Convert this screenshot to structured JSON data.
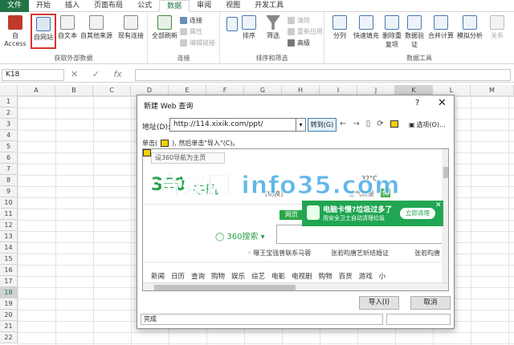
{
  "ribbon_tabs": [
    "文件",
    "开始",
    "插入",
    "页面布局",
    "公式",
    "数据",
    "审阅",
    "视图",
    "开发工具"
  ],
  "ribbon": {
    "get_external": {
      "label": "获取外部数据",
      "access": "自 Access",
      "web": "自网站",
      "text": "自文本",
      "other": "自其他来源",
      "existing": "现有连接"
    },
    "connections": {
      "label": "连接",
      "refresh_all": "全部刷新",
      "connections": "连接",
      "properties": "属性",
      "edit_links": "编辑链接"
    },
    "sort_filter": {
      "label": "排序和筛选",
      "sort": "排序",
      "filter": "筛选",
      "clear": "清除",
      "reapply": "重新应用",
      "advanced": "高级"
    },
    "data_tools": {
      "label": "数据工具",
      "split": "分列",
      "flash_fill": "快速填充",
      "remove_dup": "删除重复项",
      "validation": "数据验证",
      "consolidate": "合并计算",
      "what_if": "模拟分析",
      "relations": "关系"
    }
  },
  "name_box": "K18",
  "fx_label": "fx",
  "columns": [
    "A",
    "B",
    "C",
    "D",
    "E",
    "F",
    "G",
    "H",
    "I",
    "J",
    "K",
    "L",
    "M"
  ],
  "rows": [
    "1",
    "2",
    "3",
    "4",
    "5",
    "6",
    "7",
    "8",
    "9",
    "10",
    "11",
    "12",
    "13",
    "14",
    "15",
    "16",
    "17",
    "18",
    "19",
    "20",
    "21",
    "22"
  ],
  "dialog": {
    "title": "新建 Web 查询",
    "help": "?",
    "close": "✕",
    "address_label": "地址(D):",
    "address_value": "http://114.xixik.com/ppt/",
    "go_button": "转到(G)",
    "options": "选项(O)...",
    "hint_prefix": "单击(",
    "hint_suffix": "), 然后单击\"导入\"(C)。",
    "import_button": "导入(I)",
    "cancel_button": "取消",
    "status": "完成"
  },
  "browser": {
    "set_home": "设360导航为主页",
    "logo": "360",
    "logo_text": "导航",
    "city_switch": "[切换]",
    "temp": "32°C",
    "air_quality": "空气质量",
    "aqi": "优",
    "web_tab": "网页",
    "search_logo": "◯ 360搜索 ▾",
    "news1": "◦ 曝王宝强曾联系马蓉",
    "news2": "张若昀唐艺昕结婚证",
    "news3": "张若昀唐",
    "categories": [
      "新闻",
      "日历",
      "查询",
      "购物",
      "娱乐",
      "综艺",
      "电影",
      "电视剧",
      "购物",
      "百货",
      "游戏",
      "小"
    ],
    "popup_title": "电脑卡慢?垃圾过多了",
    "popup_sub": "用安全卫士自动清理垃圾",
    "popup_btn": "立即清理"
  },
  "watermark": "音娱网 info35.com",
  "colors": {
    "excel_green": "#217346",
    "highlight_red": "#d9332b",
    "popup_green": "#21a653"
  }
}
